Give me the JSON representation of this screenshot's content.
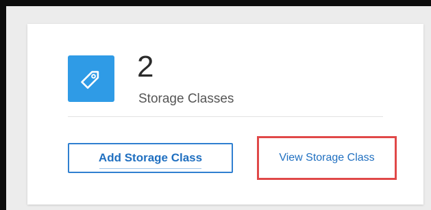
{
  "card": {
    "icon": "tag-icon",
    "count": "2",
    "count_label": "Storage Classes"
  },
  "actions": {
    "add_label": "Add Storage Class",
    "view_label": "View Storage Class"
  },
  "colors": {
    "accent": "#2f9be6",
    "link": "#1f6fc0",
    "highlight": "#e04848"
  }
}
